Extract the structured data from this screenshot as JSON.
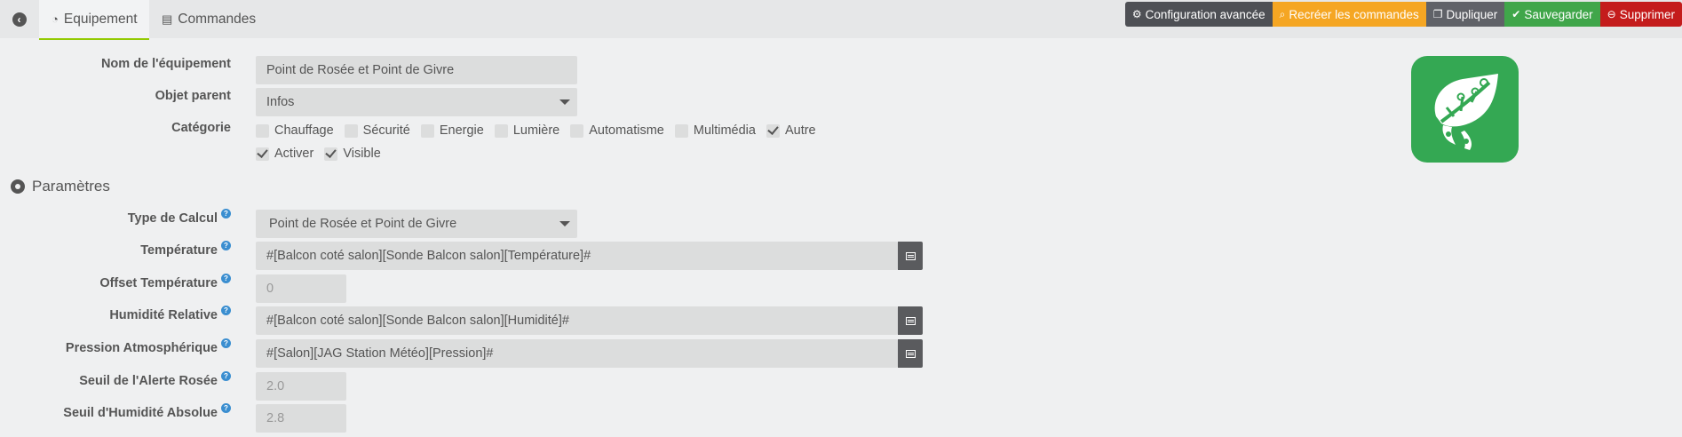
{
  "tabs": {
    "equipment": "Equipement",
    "commands": "Commandes"
  },
  "toolbar": {
    "config": "Configuration avancée",
    "recreate": "Recréer les commandes",
    "duplicate": "Dupliquer",
    "save": "Sauvegarder",
    "delete": "Supprimer"
  },
  "form": {
    "name_label": "Nom de l'équipement",
    "name_value": "Point de Rosée et Point de Givre",
    "parent_label": "Objet parent",
    "parent_value": "Infos",
    "category_label": "Catégorie",
    "categories": [
      {
        "label": "Chauffage",
        "checked": false
      },
      {
        "label": "Sécurité",
        "checked": false
      },
      {
        "label": "Energie",
        "checked": false
      },
      {
        "label": "Lumière",
        "checked": false
      },
      {
        "label": "Automatisme",
        "checked": false
      },
      {
        "label": "Multimédia",
        "checked": false
      },
      {
        "label": "Autre",
        "checked": true
      }
    ],
    "activate_label": "Activer",
    "visible_label": "Visible"
  },
  "params": {
    "section_title": "Paramètres",
    "calc_type_label": "Type de Calcul",
    "calc_type_value": "Point de Rosée et Point de Givre",
    "temp_label": "Température",
    "temp_value": "#[Balcon coté salon][Sonde Balcon salon][Température]#",
    "temp_offset_label": "Offset Température",
    "temp_offset_placeholder": "0",
    "humidity_label": "Humidité Relative",
    "humidity_value": "#[Balcon coté salon][Sonde Balcon salon][Humidité]#",
    "pressure_label": "Pression Atmosphérique",
    "pressure_value": "#[Salon][JAG Station Météo][Pression]#",
    "dew_alert_label": "Seuil de l'Alerte Rosée",
    "dew_alert_placeholder": "2.0",
    "abs_humidity_label": "Seuil d'Humidité Absolue",
    "abs_humidity_placeholder": "2.8"
  },
  "colors": {
    "logo_bg": "#34a853",
    "active_tab_border": "#93ca02"
  }
}
